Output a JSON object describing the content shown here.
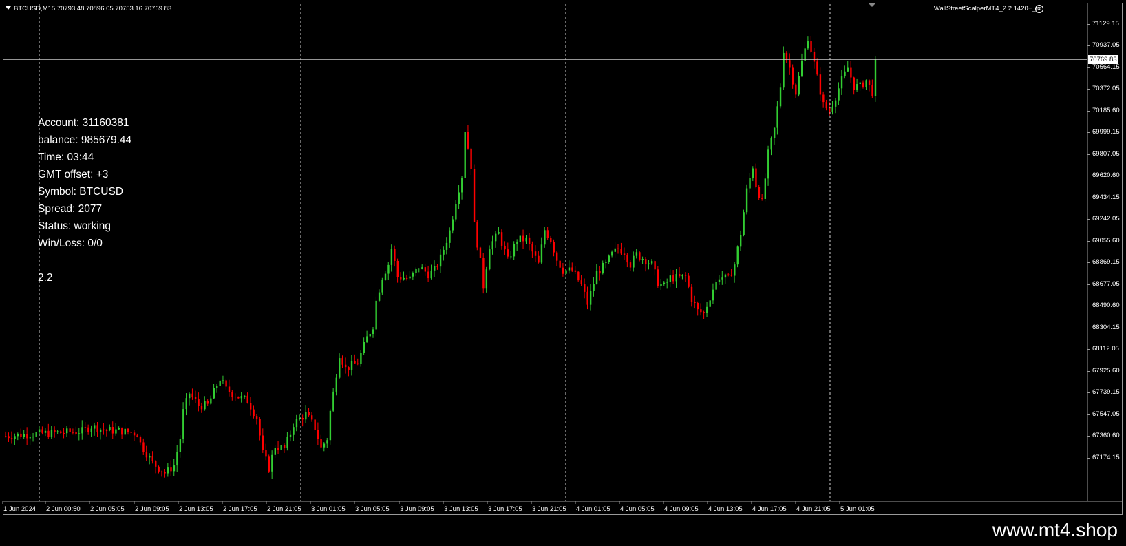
{
  "header": {
    "symbol_info": "BTCUSD,M15  70793.48 70896.05 70753.16 70769.83",
    "ea_name": "WallStreetScalperMT4_2.2 1420+_fx",
    "smiley": "☺"
  },
  "info_panel": {
    "account": "Account: 31160381",
    "balance": "balance: 985679.44",
    "time": "Time: 03:44",
    "gmt_offset": "GMT offset: +3",
    "symbol": "Symbol: BTCUSD",
    "spread": "Spread: 2077",
    "status": "Status: working",
    "winloss": "Win/Loss: 0/0",
    "version": "2.2"
  },
  "price_axis": {
    "labels": [
      "71129.15",
      "70937.05",
      "70564.15",
      "70372.05",
      "70185.60",
      "69999.15",
      "69807.05",
      "69620.60",
      "69434.15",
      "69242.05",
      "69055.60",
      "68869.15",
      "68677.05",
      "68490.60",
      "68304.15",
      "68112.05",
      "67925.60",
      "67739.15",
      "67547.05",
      "67360.60",
      "67174.15"
    ],
    "current_price": "70769.83"
  },
  "time_axis": {
    "labels": [
      "1 Jun 2024",
      "2 Jun 00:50",
      "2 Jun 05:05",
      "2 Jun 09:05",
      "2 Jun 13:05",
      "2 Jun 17:05",
      "2 Jun 21:05",
      "3 Jun 01:05",
      "3 Jun 05:05",
      "3 Jun 09:05",
      "3 Jun 13:05",
      "3 Jun 17:05",
      "3 Jun 21:05",
      "4 Jun 01:05",
      "4 Jun 05:05",
      "4 Jun 09:05",
      "4 Jun 13:05",
      "4 Jun 17:05",
      "4 Jun 21:05",
      "5 Jun 01:05"
    ]
  },
  "chart_data": {
    "type": "candlestick",
    "symbol": "BTCUSD",
    "timeframe": "M15",
    "ylim": [
      67174.15,
      71220
    ],
    "up_color": "#32cd32",
    "down_color": "#ff0000",
    "current_price": 70769.83,
    "period_separators": [
      "2 Jun 2024",
      "3 Jun 2024",
      "4 Jun 2024",
      "5 Jun 2024"
    ],
    "path_points": [
      [
        0,
        67700
      ],
      [
        10,
        67720
      ],
      [
        20,
        67730
      ],
      [
        25,
        67740
      ],
      [
        28,
        67780
      ],
      [
        32,
        67750
      ],
      [
        38,
        67740
      ],
      [
        43,
        67720
      ],
      [
        44,
        67640
      ],
      [
        48,
        67480
      ],
      [
        52,
        67400
      ],
      [
        55,
        67460
      ],
      [
        57,
        67680
      ],
      [
        58,
        67900
      ],
      [
        60,
        68050
      ],
      [
        63,
        67950
      ],
      [
        66,
        67950
      ],
      [
        70,
        68170
      ],
      [
        72,
        68080
      ],
      [
        76,
        68020
      ],
      [
        79,
        67990
      ],
      [
        82,
        67850
      ],
      [
        84,
        67560
      ],
      [
        86,
        67440
      ],
      [
        88,
        67620
      ],
      [
        91,
        67600
      ],
      [
        93,
        67720
      ],
      [
        94,
        67800
      ],
      [
        98,
        67880
      ],
      [
        101,
        67770
      ],
      [
        103,
        67600
      ],
      [
        105,
        67680
      ],
      [
        106,
        67900
      ],
      [
        107,
        68050
      ],
      [
        109,
        68370
      ],
      [
        111,
        68250
      ],
      [
        115,
        68300
      ],
      [
        118,
        68500
      ],
      [
        120,
        68600
      ],
      [
        121,
        68800
      ],
      [
        123,
        69000
      ],
      [
        125,
        69100
      ],
      [
        126,
        69230
      ],
      [
        128,
        69000
      ],
      [
        132,
        68980
      ],
      [
        135,
        69080
      ],
      [
        138,
        69020
      ],
      [
        140,
        69050
      ],
      [
        142,
        69150
      ],
      [
        145,
        69370
      ],
      [
        147,
        69620
      ],
      [
        149,
        69820
      ],
      [
        150,
        70200
      ],
      [
        152,
        69900
      ],
      [
        153,
        69420
      ],
      [
        155,
        69120
      ],
      [
        156,
        68920
      ],
      [
        158,
        69250
      ],
      [
        161,
        69350
      ],
      [
        164,
        69130
      ],
      [
        167,
        69300
      ],
      [
        170,
        69300
      ],
      [
        172,
        69200
      ],
      [
        174,
        69100
      ],
      [
        176,
        69380
      ],
      [
        178,
        69300
      ],
      [
        180,
        69140
      ],
      [
        182,
        69050
      ],
      [
        185,
        69050
      ],
      [
        188,
        68930
      ],
      [
        190,
        68780
      ],
      [
        193,
        69030
      ],
      [
        196,
        69100
      ],
      [
        198,
        69180
      ],
      [
        200,
        69230
      ],
      [
        202,
        69200
      ],
      [
        204,
        69100
      ],
      [
        206,
        69180
      ],
      [
        208,
        69150
      ],
      [
        211,
        69100
      ],
      [
        213,
        68950
      ],
      [
        215,
        68920
      ],
      [
        217,
        68990
      ],
      [
        220,
        68990
      ],
      [
        222,
        69000
      ],
      [
        224,
        68820
      ],
      [
        226,
        68720
      ],
      [
        228,
        68700
      ],
      [
        231,
        68900
      ],
      [
        233,
        69000
      ],
      [
        236,
        68980
      ],
      [
        238,
        69100
      ],
      [
        240,
        69350
      ],
      [
        242,
        69700
      ],
      [
        244,
        69900
      ],
      [
        245,
        69750
      ],
      [
        247,
        69600
      ],
      [
        249,
        70000
      ],
      [
        251,
        70200
      ],
      [
        253,
        70550
      ],
      [
        254,
        70850
      ],
      [
        256,
        70700
      ],
      [
        258,
        70500
      ],
      [
        260,
        70750
      ],
      [
        262,
        70950
      ],
      [
        263,
        70850
      ],
      [
        265,
        70620
      ],
      [
        267,
        70400
      ],
      [
        269,
        70350
      ],
      [
        271,
        70470
      ],
      [
        273,
        70600
      ],
      [
        275,
        70700
      ],
      [
        277,
        70550
      ],
      [
        279,
        70550
      ],
      [
        281,
        70600
      ],
      [
        283,
        70500
      ],
      [
        284,
        70770
      ]
    ]
  },
  "watermark": "www.mt4.shop"
}
